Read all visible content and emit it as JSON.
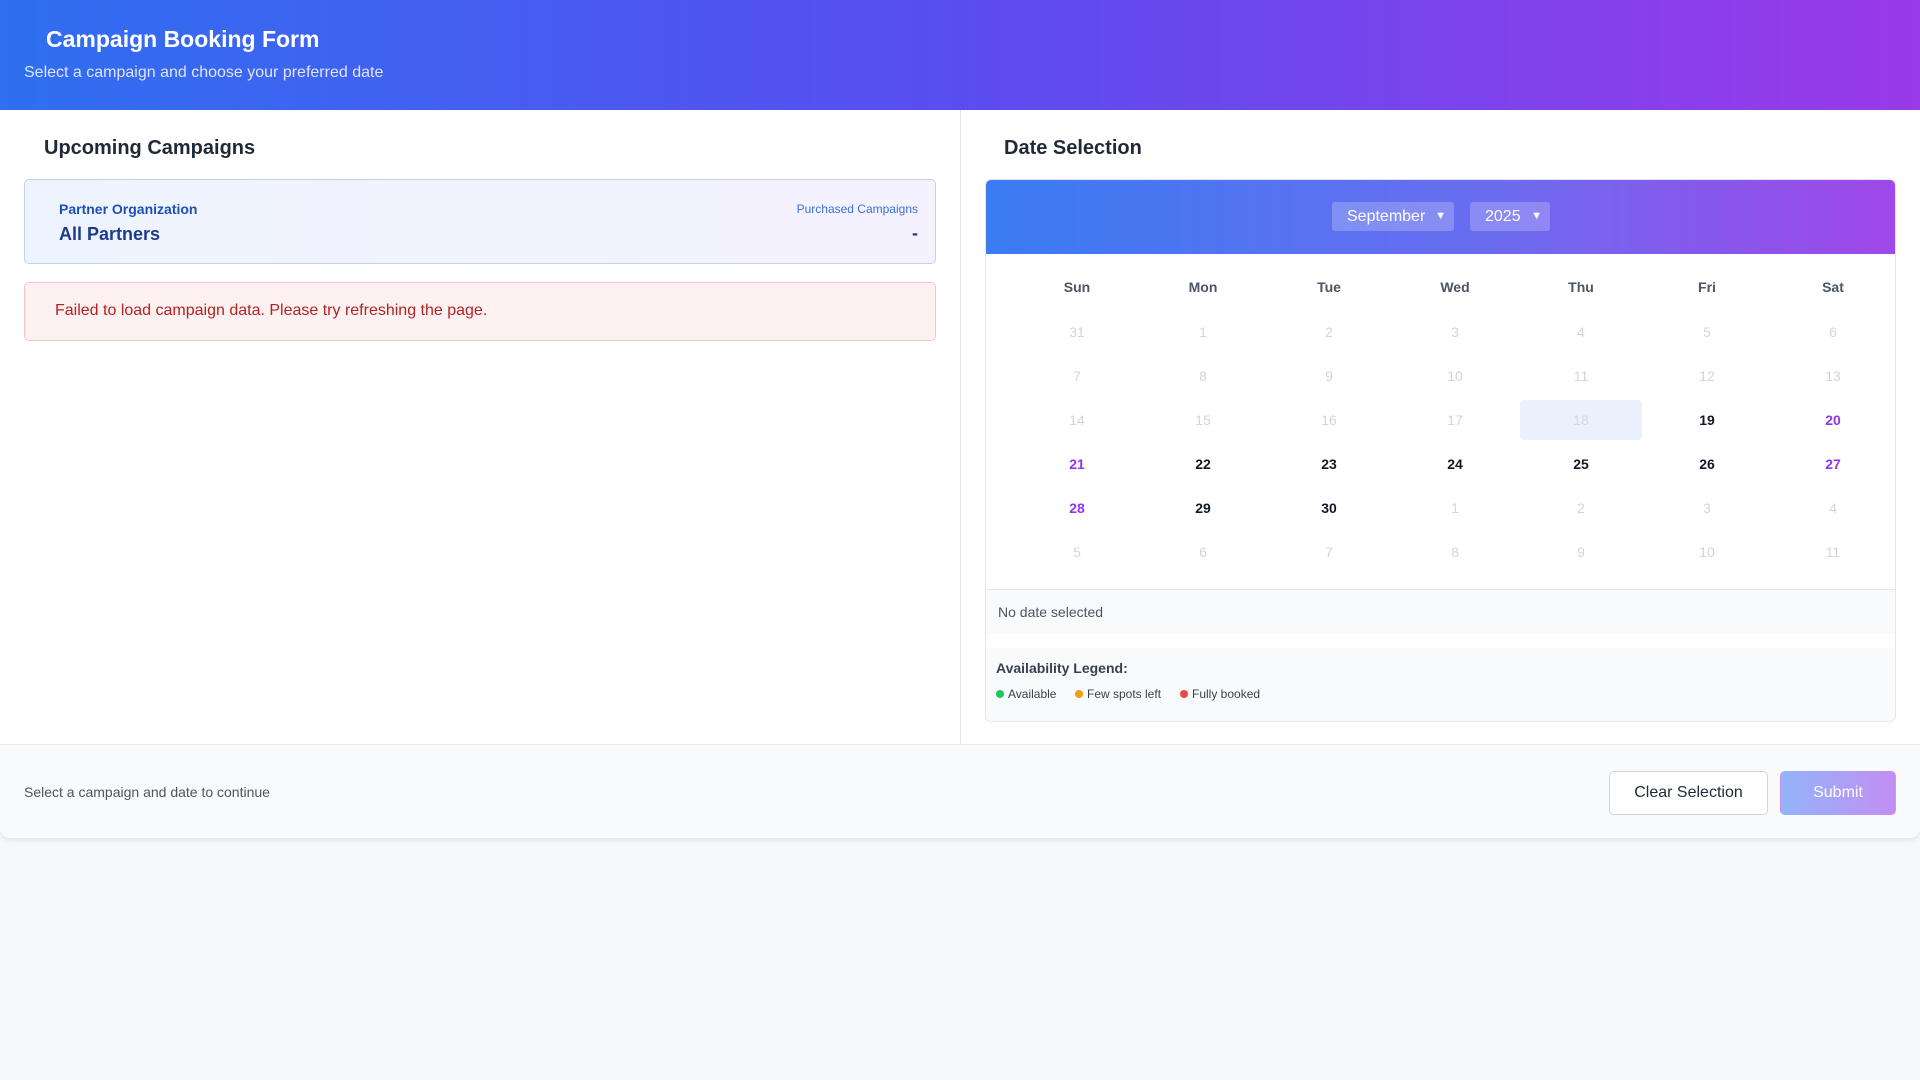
{
  "header": {
    "title": "Campaign Booking Form",
    "subtitle": "Select a campaign and choose your preferred date"
  },
  "campaigns": {
    "title": "Upcoming Campaigns",
    "partner_label": "Partner Organization",
    "partner_value": "All Partners",
    "purchased_label": "Purchased Campaigns",
    "purchased_value": "-",
    "error_message": "Failed to load campaign data. Please try refreshing the page."
  },
  "date_selection": {
    "title": "Date Selection",
    "month": "September",
    "year": "2025",
    "weekdays": [
      "Sun",
      "Mon",
      "Tue",
      "Wed",
      "Thu",
      "Fri",
      "Sat"
    ],
    "weeks": [
      [
        {
          "d": "31",
          "s": "faded"
        },
        {
          "d": "1",
          "s": "faded"
        },
        {
          "d": "2",
          "s": "faded"
        },
        {
          "d": "3",
          "s": "faded"
        },
        {
          "d": "4",
          "s": "faded"
        },
        {
          "d": "5",
          "s": "faded"
        },
        {
          "d": "6",
          "s": "faded"
        }
      ],
      [
        {
          "d": "7",
          "s": "faded"
        },
        {
          "d": "8",
          "s": "faded"
        },
        {
          "d": "9",
          "s": "faded"
        },
        {
          "d": "10",
          "s": "faded"
        },
        {
          "d": "11",
          "s": "faded"
        },
        {
          "d": "12",
          "s": "faded"
        },
        {
          "d": "13",
          "s": "faded"
        }
      ],
      [
        {
          "d": "14",
          "s": "faded"
        },
        {
          "d": "15",
          "s": "faded"
        },
        {
          "d": "16",
          "s": "faded"
        },
        {
          "d": "17",
          "s": "faded"
        },
        {
          "d": "18",
          "s": "today"
        },
        {
          "d": "19",
          "s": "active"
        },
        {
          "d": "20",
          "s": "weekend"
        }
      ],
      [
        {
          "d": "21",
          "s": "weekend"
        },
        {
          "d": "22",
          "s": "active"
        },
        {
          "d": "23",
          "s": "active"
        },
        {
          "d": "24",
          "s": "active"
        },
        {
          "d": "25",
          "s": "active"
        },
        {
          "d": "26",
          "s": "active"
        },
        {
          "d": "27",
          "s": "weekend"
        }
      ],
      [
        {
          "d": "28",
          "s": "weekend"
        },
        {
          "d": "29",
          "s": "active"
        },
        {
          "d": "30",
          "s": "active"
        },
        {
          "d": "1",
          "s": "faded"
        },
        {
          "d": "2",
          "s": "faded"
        },
        {
          "d": "3",
          "s": "faded"
        },
        {
          "d": "4",
          "s": "faded"
        }
      ],
      [
        {
          "d": "5",
          "s": "faded"
        },
        {
          "d": "6",
          "s": "faded"
        },
        {
          "d": "7",
          "s": "faded"
        },
        {
          "d": "8",
          "s": "faded"
        },
        {
          "d": "9",
          "s": "faded"
        },
        {
          "d": "10",
          "s": "faded"
        },
        {
          "d": "11",
          "s": "faded"
        }
      ]
    ],
    "status": "No date selected",
    "legend_title": "Availability Legend:",
    "legend": [
      {
        "label": "Available",
        "color": "#22c55e"
      },
      {
        "label": "Few spots left",
        "color": "#f59e0b"
      },
      {
        "label": "Fully booked",
        "color": "#ef4444"
      }
    ]
  },
  "footer": {
    "hint": "Select a campaign and date to continue",
    "clear_label": "Clear Selection",
    "submit_label": "Submit"
  },
  "colors": {
    "accent_blue": "#2f6ff0",
    "accent_purple": "#9a3ae8",
    "weekend": "#9333ea",
    "error": "#b42323"
  }
}
